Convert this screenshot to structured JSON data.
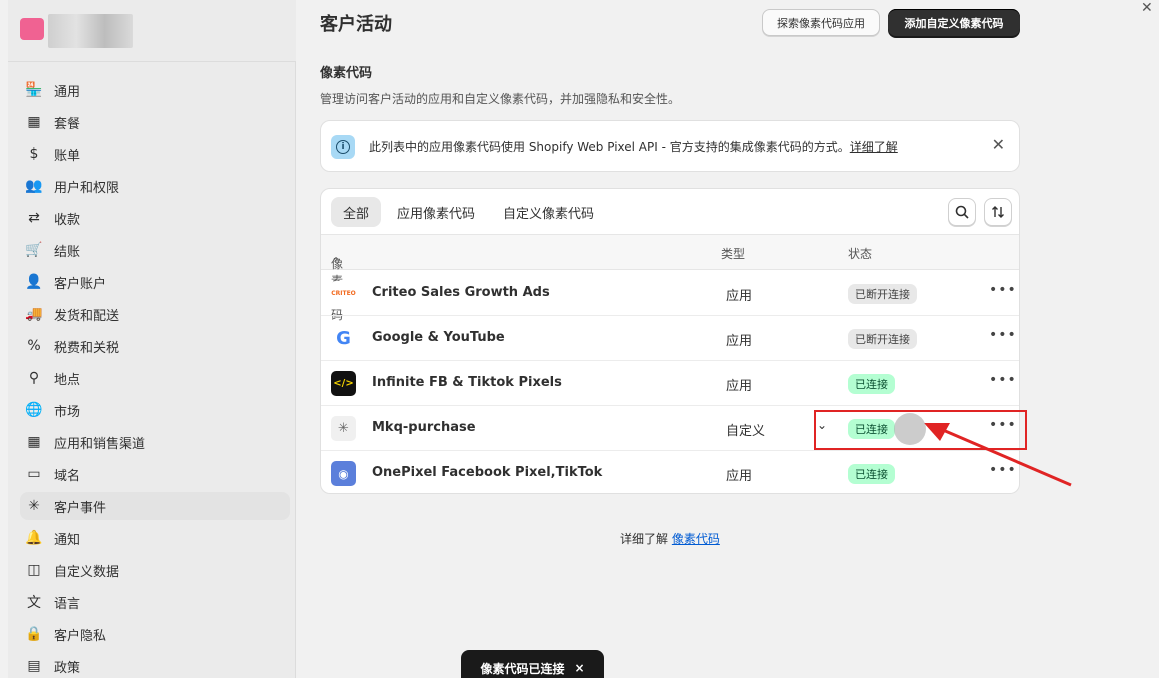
{
  "sidebar": {
    "items": [
      {
        "label": "通用",
        "icon": "store-icon",
        "glyph": "🏪",
        "active": false
      },
      {
        "label": "套餐",
        "icon": "plan-icon",
        "glyph": "▦",
        "active": false
      },
      {
        "label": "账单",
        "icon": "billing-icon",
        "glyph": "$",
        "active": false
      },
      {
        "label": "用户和权限",
        "icon": "users-icon",
        "glyph": "👥",
        "active": false
      },
      {
        "label": "收款",
        "icon": "payments-icon",
        "glyph": "⇄",
        "active": false
      },
      {
        "label": "结账",
        "icon": "cart-icon",
        "glyph": "🛒",
        "active": false
      },
      {
        "label": "客户账户",
        "icon": "person-icon",
        "glyph": "👤",
        "active": false
      },
      {
        "label": "发货和配送",
        "icon": "truck-icon",
        "glyph": "🚚",
        "active": false
      },
      {
        "label": "税费和关税",
        "icon": "tax-icon",
        "glyph": "%",
        "active": false
      },
      {
        "label": "地点",
        "icon": "location-icon",
        "glyph": "⚲",
        "active": false
      },
      {
        "label": "市场",
        "icon": "globe-icon",
        "glyph": "🌐",
        "active": false
      },
      {
        "label": "应用和销售渠道",
        "icon": "apps-icon",
        "glyph": "▦",
        "active": false
      },
      {
        "label": "域名",
        "icon": "domain-icon",
        "glyph": "▭",
        "active": false
      },
      {
        "label": "客户事件",
        "icon": "pixel-icon",
        "glyph": "✳",
        "active": true
      },
      {
        "label": "通知",
        "icon": "bell-icon",
        "glyph": "🔔",
        "active": false
      },
      {
        "label": "自定义数据",
        "icon": "metafields-icon",
        "glyph": "◫",
        "active": false
      },
      {
        "label": "语言",
        "icon": "language-icon",
        "glyph": "文",
        "active": false
      },
      {
        "label": "客户隐私",
        "icon": "lock-icon",
        "glyph": "🔒",
        "active": false
      },
      {
        "label": "政策",
        "icon": "policy-icon",
        "glyph": "▤",
        "active": false
      }
    ]
  },
  "header": {
    "title": "客户活动",
    "secondary_button": "探索像素代码应用",
    "primary_button": "添加自定义像素代码"
  },
  "section": {
    "title": "像素代码",
    "description": "管理访问客户活动的应用和自定义像素代码，并加强隐私和安全性。"
  },
  "banner": {
    "text": "此列表中的应用像素代码使用 Shopify Web Pixel API - 官方支持的集成像素代码的方式。",
    "link": "详细了解"
  },
  "tabs": [
    "全部",
    "应用像素代码",
    "自定义像素代码"
  ],
  "table": {
    "headers": {
      "name": "像素代码",
      "type": "类型",
      "status": "状态"
    },
    "rows": [
      {
        "name": "Criteo Sales Growth Ads",
        "type": "应用",
        "status": "已断开连接",
        "connected": false,
        "logo_text": "CRITEO"
      },
      {
        "name": "Google & YouTube",
        "type": "应用",
        "status": "已断开连接",
        "connected": false,
        "logo_text": "G"
      },
      {
        "name": "Infinite FB & Tiktok Pixels",
        "type": "应用",
        "status": "已连接",
        "connected": true,
        "logo_text": "</>"
      },
      {
        "name": "Mkq-purchase",
        "type": "自定义",
        "status": "已连接",
        "connected": true,
        "logo_text": "✳"
      },
      {
        "name": "OnePixel Facebook Pixel,TikTok",
        "type": "应用",
        "status": "已连接",
        "connected": true,
        "logo_text": "◉"
      }
    ]
  },
  "footer": {
    "prefix": "详细了解",
    "link": "像素代码"
  },
  "toast": {
    "text": "像素代码已连接",
    "close": "×"
  },
  "colors": {
    "accent_primary": "#303030",
    "badge_connected": "#b4fed2",
    "badge_disconnected": "#e8e8e8",
    "link": "#005bd3",
    "highlight": "#e02424"
  }
}
